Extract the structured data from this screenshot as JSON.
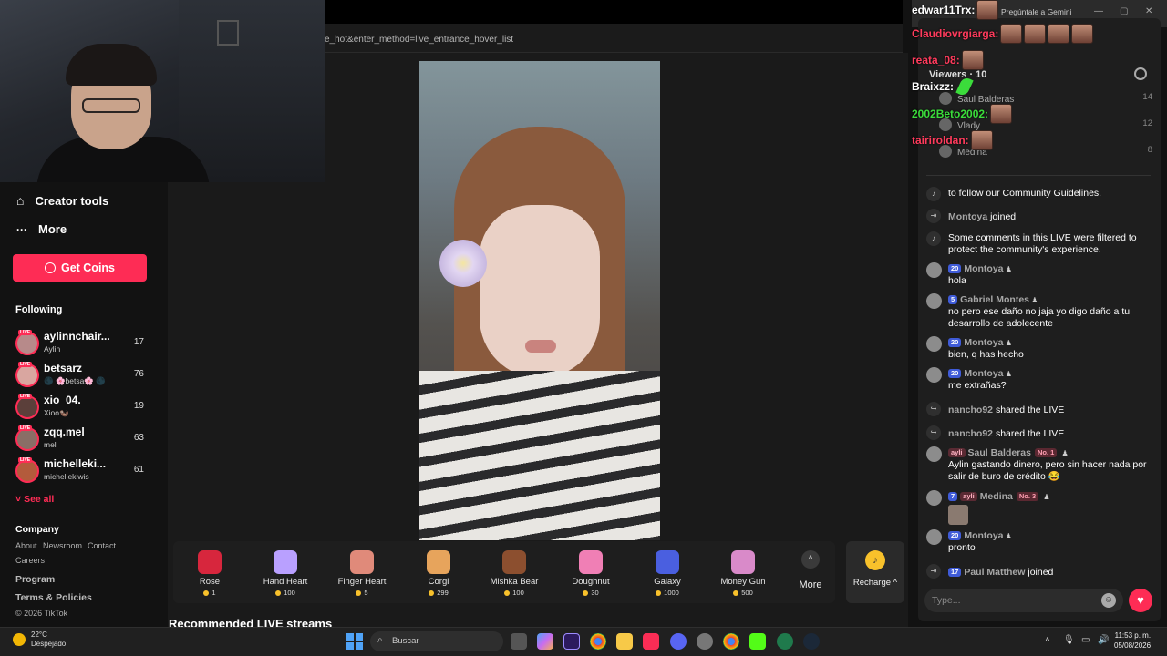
{
  "browser": {
    "url_fragment": "e_hot&enter_method=live_entrance_hover_list",
    "gemini_label": "Pregúntale a Gemini"
  },
  "sidebar": {
    "nav": [
      {
        "label": "Creator tools",
        "icon": "creator-tools-icon"
      },
      {
        "label": "More",
        "icon": "more-dots-icon"
      }
    ],
    "get_coins_label": "Get Coins",
    "following_title": "Following",
    "following": [
      {
        "name": "aylinnchair...",
        "sub": "Aylin",
        "count": "17",
        "avatar_color": "#b78a8a"
      },
      {
        "name": "betsarz",
        "sub": "🌑 🌸betsa🌸 🌑",
        "count": "76",
        "avatar_color": "#d9a6a0"
      },
      {
        "name": "xio_04._",
        "sub": "Xioo🦦",
        "count": "19",
        "avatar_color": "#5b3f3a"
      },
      {
        "name": "zqq.mel",
        "sub": "mel",
        "count": "63",
        "avatar_color": "#8a6e66"
      },
      {
        "name": "michelleki...",
        "sub": "michellekiwis",
        "count": "61",
        "avatar_color": "#b35b3c"
      }
    ],
    "live_badge": "LIVE",
    "see_all": "See all",
    "company_title": "Company",
    "company_links": [
      "About",
      "Newsroom",
      "Contact",
      "Careers"
    ],
    "program": "Program",
    "terms": "Terms & Policies",
    "copyright": "© 2026 TikTok"
  },
  "gifts": [
    {
      "name": "Rose",
      "price": "1",
      "color": "#d7263d"
    },
    {
      "name": "Hand Heart",
      "price": "100",
      "color": "#b9a0ff"
    },
    {
      "name": "Finger Heart",
      "price": "5",
      "color": "#e08a7a"
    },
    {
      "name": "Corgi",
      "price": "299",
      "color": "#e7a45c"
    },
    {
      "name": "Mishka Bear",
      "price": "100",
      "color": "#8c4f2f"
    },
    {
      "name": "Doughnut",
      "price": "30",
      "color": "#f07fb5"
    },
    {
      "name": "Galaxy",
      "price": "1000",
      "color": "#4a5fe0"
    },
    {
      "name": "Money Gun",
      "price": "500",
      "color": "#d98ac9"
    }
  ],
  "more_label": "More",
  "recharge_label": "Recharge ^",
  "recommended_title": "Recommended LIVE streams",
  "viewers": {
    "title": "Viewers · 10",
    "rows": [
      {
        "name": "Saul Balderas",
        "count": "14"
      },
      {
        "name": "Vlady",
        "count": "12"
      },
      {
        "name": "Medina",
        "count": "8"
      }
    ]
  },
  "chat": [
    {
      "type": "system",
      "text": "to follow our Community Guidelines.",
      "icon": "tiktok-icon"
    },
    {
      "type": "join",
      "user": "Montoya",
      "action": "joined"
    },
    {
      "type": "system",
      "text": "Some comments in this LIVE were filtered to protect the community's experience.",
      "icon": "tiktok-icon"
    },
    {
      "type": "msg",
      "user": "Montoya",
      "level": "20",
      "text": "hola"
    },
    {
      "type": "msg",
      "user": "Gabriel Montes",
      "level": "5",
      "text": "no pero ese daño no jaja yo digo daño a tu desarrollo de adolecente"
    },
    {
      "type": "msg",
      "user": "Montoya",
      "level": "20",
      "text": "bien, q has hecho"
    },
    {
      "type": "msg",
      "user": "Montoya",
      "level": "20",
      "text": "me extrañas?"
    },
    {
      "type": "share",
      "user": "nancho92",
      "action": "shared the LIVE"
    },
    {
      "type": "share",
      "user": "nancho92",
      "action": "shared the LIVE"
    },
    {
      "type": "msg",
      "user": "Saul Balderas",
      "fan": "ayli",
      "rank": "No. 1",
      "text": "Aylin gastando dinero, pero sin hacer nada por salir de buro de crédito 😂"
    },
    {
      "type": "msg",
      "user": "Medina",
      "level": "7",
      "fan": "ayli",
      "rank": "No. 3",
      "text": ""
    },
    {
      "type": "msg",
      "user": "Montoya",
      "level": "20",
      "text": "pronto"
    },
    {
      "type": "join",
      "user": "Paul Matthew",
      "level": "17",
      "action": "joined"
    }
  ],
  "input_placeholder": "Type...",
  "overlay_chat": [
    {
      "user": "edwar11Trx:",
      "color": "#ffffff",
      "emotes": 1
    },
    {
      "user": "Claudiovrgiarga:",
      "color": "#ff3b5c",
      "emotes": 4
    },
    {
      "user": "reata_08:",
      "color": "#ff3b5c",
      "emotes": 1
    },
    {
      "user": "Braixzz:",
      "color": "#ffffff",
      "emotes": 0
    },
    {
      "user": "2002Beto2002:",
      "color": "#3bdc3b",
      "emotes": 1
    },
    {
      "user": "tairiroldan:",
      "color": "#ff3b5c",
      "emotes": 1
    }
  ],
  "taskbar": {
    "temp": "22°C",
    "weather": "Despejado",
    "search": "Buscar",
    "time": "11:53 p. m.",
    "date": "05/08/2026"
  }
}
